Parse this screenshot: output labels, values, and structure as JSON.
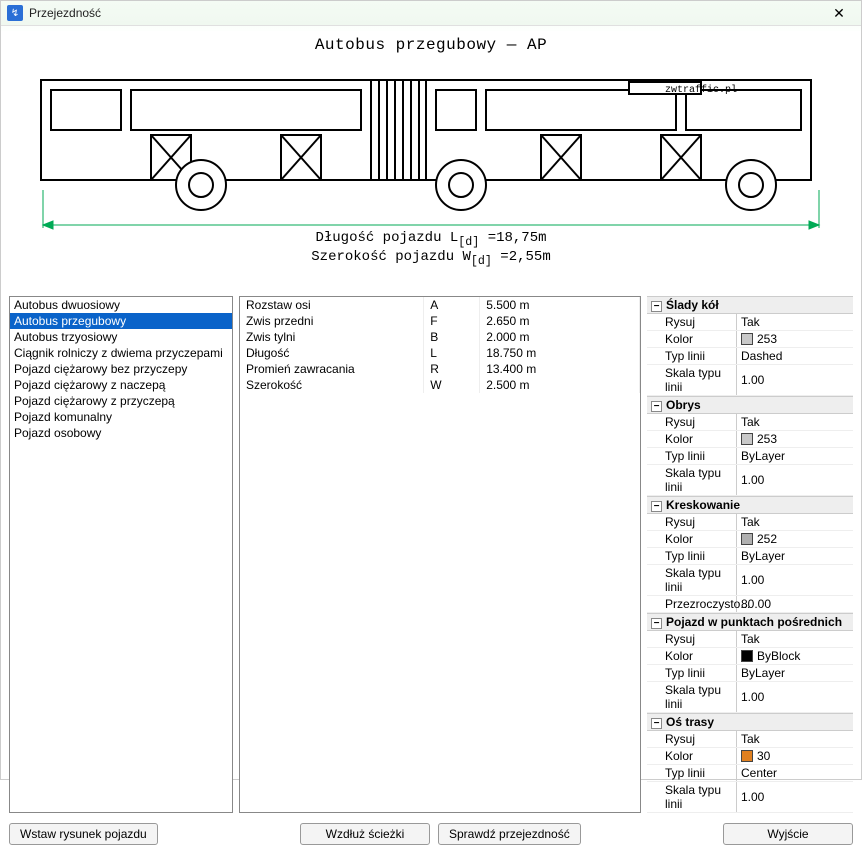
{
  "window": {
    "title": "Przejezdność"
  },
  "diagram": {
    "title": "Autobus przegubowy — AP",
    "length_label": "Długość pojazdu L",
    "length_sub": "[d]",
    "length_eq": " =18,75m",
    "width_label": "Szerokość pojazdu W",
    "width_sub": "[d]",
    "width_eq": " =2,55m",
    "branding": "zwtraffic.pl"
  },
  "vehicles": [
    "Autobus dwuosiowy",
    "Autobus przegubowy",
    "Autobus trzyosiowy",
    "Ciągnik rolniczy z dwiema przyczepami",
    "Pojazd ciężarowy bez przyczepy",
    "Pojazd ciężarowy z naczepą",
    "Pojazd ciężarowy z przyczepą",
    "Pojazd komunalny",
    "Pojazd osobowy"
  ],
  "selected_vehicle_index": 1,
  "params": [
    {
      "name": "Rozstaw osi",
      "sym": "A",
      "value": "5.500 m"
    },
    {
      "name": "Zwis przedni",
      "sym": "F",
      "value": "2.650 m"
    },
    {
      "name": "Zwis tylni",
      "sym": "B",
      "value": "2.000 m"
    },
    {
      "name": "Długość",
      "sym": "L",
      "value": "18.750 m"
    },
    {
      "name": "Promień zawracania",
      "sym": "R",
      "value": "13.400 m"
    },
    {
      "name": "Szerokość",
      "sym": "W",
      "value": "2.500 m"
    }
  ],
  "props": {
    "cat1": "Ślady kół",
    "c1_rysuj_k": "Rysuj",
    "c1_rysuj_v": "Tak",
    "c1_kolor_k": "Kolor",
    "c1_kolor_v": "253",
    "c1_kolor_sw": "#c8c8c8",
    "c1_typ_k": "Typ linii",
    "c1_typ_v": "Dashed",
    "c1_skala_k": "Skala typu linii",
    "c1_skala_v": "1.00",
    "cat2": "Obrys",
    "c2_rysuj_k": "Rysuj",
    "c2_rysuj_v": "Tak",
    "c2_kolor_k": "Kolor",
    "c2_kolor_v": "253",
    "c2_kolor_sw": "#c8c8c8",
    "c2_typ_k": "Typ linii",
    "c2_typ_v": "ByLayer",
    "c2_skala_k": "Skala typu linii",
    "c2_skala_v": "1.00",
    "cat3": "Kreskowanie",
    "c3_rysuj_k": "Rysuj",
    "c3_rysuj_v": "Tak",
    "c3_kolor_k": "Kolor",
    "c3_kolor_v": "252",
    "c3_kolor_sw": "#b0b0b0",
    "c3_typ_k": "Typ linii",
    "c3_typ_v": "ByLayer",
    "c3_skala_k": "Skala typu linii",
    "c3_skala_v": "1.00",
    "c3_przez_k": "Przezroczysto...",
    "c3_przez_v": "80.00",
    "cat4": "Pojazd w punktach pośrednich",
    "c4_rysuj_k": "Rysuj",
    "c4_rysuj_v": "Tak",
    "c4_kolor_k": "Kolor",
    "c4_kolor_v": "ByBlock",
    "c4_kolor_sw": "#000000",
    "c4_typ_k": "Typ linii",
    "c4_typ_v": "ByLayer",
    "c4_skala_k": "Skala typu linii",
    "c4_skala_v": "1.00",
    "cat5": "Oś trasy",
    "c5_rysuj_k": "Rysuj",
    "c5_rysuj_v": "Tak",
    "c5_kolor_k": "Kolor",
    "c5_kolor_v": "30",
    "c5_kolor_sw": "#e08020",
    "c5_typ_k": "Typ linii",
    "c5_typ_v": "Center",
    "c5_skala_k": "Skala typu linii",
    "c5_skala_v": "1.00"
  },
  "buttons": {
    "insert": "Wstaw rysunek pojazdu",
    "along": "Wzdłuż ścieżki",
    "check": "Sprawdź przejezdność",
    "exit": "Wyjście"
  }
}
